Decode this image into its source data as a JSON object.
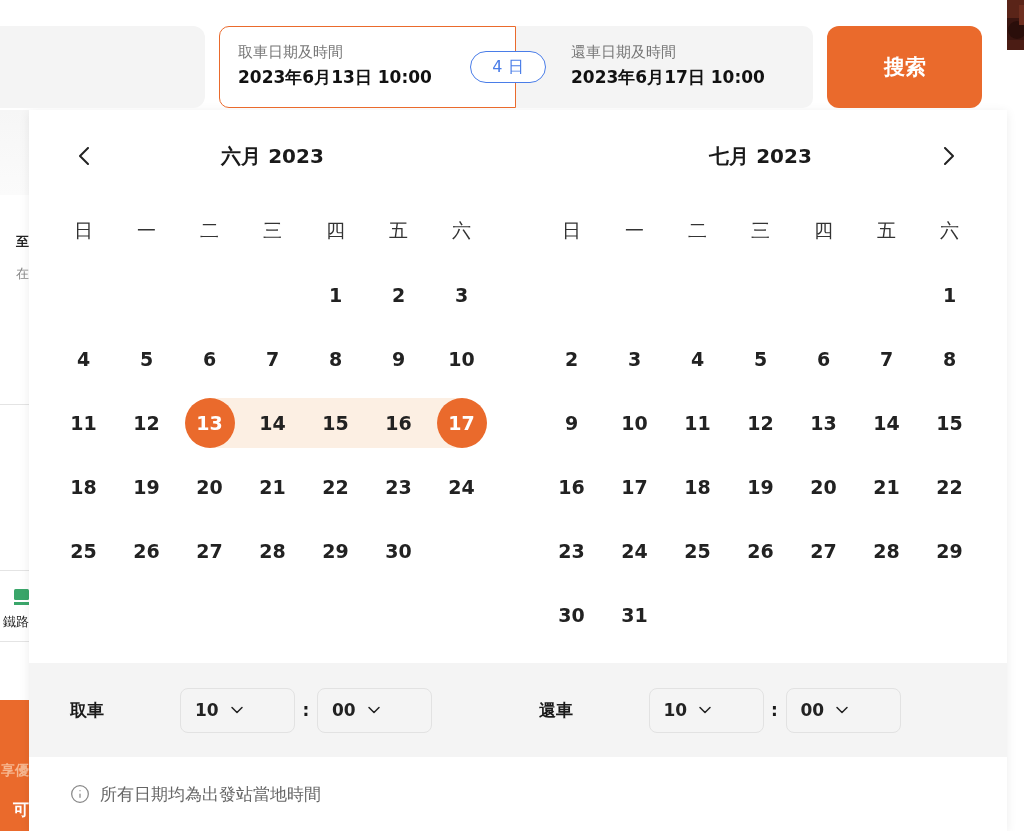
{
  "search_bar": {
    "pickup": {
      "label": "取車日期及時間",
      "value": "2023年6月13日 10:00",
      "selected": true
    },
    "duration_badge": "4 日",
    "return": {
      "label": "還車日期及時間",
      "value": "2023年6月17日 10:00",
      "selected": false
    },
    "search_button": "搜索"
  },
  "background_fragments": [
    {
      "kind": "title",
      "text": "至"
    },
    {
      "kind": "subtitle",
      "text": "在"
    },
    {
      "kind": "rail",
      "text": "鐵路"
    },
    {
      "kind": "promo",
      "text": "享優"
    },
    {
      "kind": "promo_big",
      "text": "可"
    }
  ],
  "calendar": {
    "months": [
      {
        "title": "六月 2023",
        "weekdays": [
          "日",
          "一",
          "二",
          "三",
          "四",
          "五",
          "六"
        ],
        "weeks": [
          [
            {
              "kind": "blank"
            },
            {
              "kind": "blank"
            },
            {
              "kind": "blank"
            },
            {
              "kind": "blank"
            },
            {
              "kind": "day",
              "day": "1",
              "selected": false,
              "in_range": false
            },
            {
              "kind": "day",
              "day": "2",
              "selected": false,
              "in_range": false
            },
            {
              "kind": "day",
              "day": "3",
              "selected": false,
              "in_range": false
            }
          ],
          [
            {
              "kind": "day",
              "day": "4",
              "selected": false,
              "in_range": false
            },
            {
              "kind": "day",
              "day": "5",
              "selected": false,
              "in_range": false
            },
            {
              "kind": "day",
              "day": "6",
              "selected": false,
              "in_range": false
            },
            {
              "kind": "day",
              "day": "7",
              "selected": false,
              "in_range": false
            },
            {
              "kind": "day",
              "day": "8",
              "selected": false,
              "in_range": false
            },
            {
              "kind": "day",
              "day": "9",
              "selected": false,
              "in_range": false
            },
            {
              "kind": "day",
              "day": "10",
              "selected": false,
              "in_range": false
            }
          ],
          [
            {
              "kind": "day",
              "day": "11",
              "selected": false,
              "in_range": false
            },
            {
              "kind": "day",
              "day": "12",
              "selected": false,
              "in_range": false
            },
            {
              "kind": "day",
              "day": "13",
              "selected": true,
              "in_range": true
            },
            {
              "kind": "day",
              "day": "14",
              "selected": false,
              "in_range": true
            },
            {
              "kind": "day",
              "day": "15",
              "selected": false,
              "in_range": true
            },
            {
              "kind": "day",
              "day": "16",
              "selected": false,
              "in_range": true
            },
            {
              "kind": "day",
              "day": "17",
              "selected": true,
              "in_range": true
            }
          ],
          [
            {
              "kind": "day",
              "day": "18",
              "selected": false,
              "in_range": false
            },
            {
              "kind": "day",
              "day": "19",
              "selected": false,
              "in_range": false
            },
            {
              "kind": "day",
              "day": "20",
              "selected": false,
              "in_range": false
            },
            {
              "kind": "day",
              "day": "21",
              "selected": false,
              "in_range": false
            },
            {
              "kind": "day",
              "day": "22",
              "selected": false,
              "in_range": false
            },
            {
              "kind": "day",
              "day": "23",
              "selected": false,
              "in_range": false
            },
            {
              "kind": "day",
              "day": "24",
              "selected": false,
              "in_range": false
            }
          ],
          [
            {
              "kind": "day",
              "day": "25",
              "selected": false,
              "in_range": false
            },
            {
              "kind": "day",
              "day": "26",
              "selected": false,
              "in_range": false
            },
            {
              "kind": "day",
              "day": "27",
              "selected": false,
              "in_range": false
            },
            {
              "kind": "day",
              "day": "28",
              "selected": false,
              "in_range": false
            },
            {
              "kind": "day",
              "day": "29",
              "selected": false,
              "in_range": false
            },
            {
              "kind": "day",
              "day": "30",
              "selected": false,
              "in_range": false
            },
            {
              "kind": "blank"
            }
          ]
        ]
      },
      {
        "title": "七月 2023",
        "weekdays": [
          "日",
          "一",
          "二",
          "三",
          "四",
          "五",
          "六"
        ],
        "weeks": [
          [
            {
              "kind": "blank"
            },
            {
              "kind": "blank"
            },
            {
              "kind": "blank"
            },
            {
              "kind": "blank"
            },
            {
              "kind": "blank"
            },
            {
              "kind": "blank"
            },
            {
              "kind": "day",
              "day": "1",
              "selected": false,
              "in_range": false
            }
          ],
          [
            {
              "kind": "day",
              "day": "2",
              "selected": false,
              "in_range": false
            },
            {
              "kind": "day",
              "day": "3",
              "selected": false,
              "in_range": false
            },
            {
              "kind": "day",
              "day": "4",
              "selected": false,
              "in_range": false
            },
            {
              "kind": "day",
              "day": "5",
              "selected": false,
              "in_range": false
            },
            {
              "kind": "day",
              "day": "6",
              "selected": false,
              "in_range": false
            },
            {
              "kind": "day",
              "day": "7",
              "selected": false,
              "in_range": false
            },
            {
              "kind": "day",
              "day": "8",
              "selected": false,
              "in_range": false
            }
          ],
          [
            {
              "kind": "day",
              "day": "9",
              "selected": false,
              "in_range": false
            },
            {
              "kind": "day",
              "day": "10",
              "selected": false,
              "in_range": false
            },
            {
              "kind": "day",
              "day": "11",
              "selected": false,
              "in_range": false
            },
            {
              "kind": "day",
              "day": "12",
              "selected": false,
              "in_range": false
            },
            {
              "kind": "day",
              "day": "13",
              "selected": false,
              "in_range": false
            },
            {
              "kind": "day",
              "day": "14",
              "selected": false,
              "in_range": false
            },
            {
              "kind": "day",
              "day": "15",
              "selected": false,
              "in_range": false
            }
          ],
          [
            {
              "kind": "day",
              "day": "16",
              "selected": false,
              "in_range": false
            },
            {
              "kind": "day",
              "day": "17",
              "selected": false,
              "in_range": false
            },
            {
              "kind": "day",
              "day": "18",
              "selected": false,
              "in_range": false
            },
            {
              "kind": "day",
              "day": "19",
              "selected": false,
              "in_range": false
            },
            {
              "kind": "day",
              "day": "20",
              "selected": false,
              "in_range": false
            },
            {
              "kind": "day",
              "day": "21",
              "selected": false,
              "in_range": false
            },
            {
              "kind": "day",
              "day": "22",
              "selected": false,
              "in_range": false
            }
          ],
          [
            {
              "kind": "day",
              "day": "23",
              "selected": false,
              "in_range": false
            },
            {
              "kind": "day",
              "day": "24",
              "selected": false,
              "in_range": false
            },
            {
              "kind": "day",
              "day": "25",
              "selected": false,
              "in_range": false
            },
            {
              "kind": "day",
              "day": "26",
              "selected": false,
              "in_range": false
            },
            {
              "kind": "day",
              "day": "27",
              "selected": false,
              "in_range": false
            },
            {
              "kind": "day",
              "day": "28",
              "selected": false,
              "in_range": false
            },
            {
              "kind": "day",
              "day": "29",
              "selected": false,
              "in_range": false
            }
          ],
          [
            {
              "kind": "day",
              "day": "30",
              "selected": false,
              "in_range": false
            },
            {
              "kind": "day",
              "day": "31",
              "selected": false,
              "in_range": false
            },
            {
              "kind": "blank"
            },
            {
              "kind": "blank"
            },
            {
              "kind": "blank"
            },
            {
              "kind": "blank"
            },
            {
              "kind": "blank"
            }
          ]
        ]
      }
    ],
    "times": [
      {
        "label": "取車",
        "hour": "10",
        "separator": ":",
        "minute": "00"
      },
      {
        "label": "還車",
        "hour": "10",
        "separator": ":",
        "minute": "00"
      }
    ],
    "note": "所有日期均為出發站當地時間"
  }
}
